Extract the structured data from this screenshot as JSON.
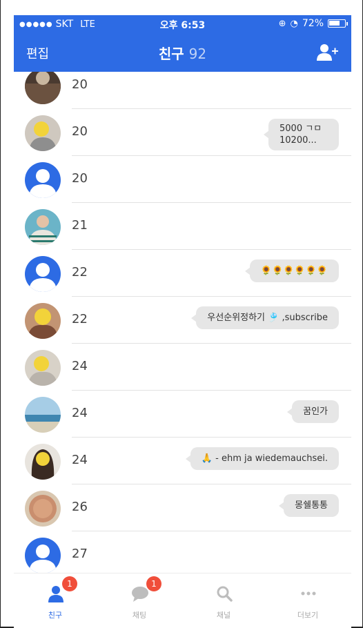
{
  "status": {
    "carrier": "SKT",
    "network": "LTE",
    "time": "오후 6:53",
    "battery": "72%",
    "battery_level": 0.72
  },
  "navbar": {
    "edit_label": "편집",
    "title": "친구",
    "count": "92"
  },
  "friends": [
    {
      "name": "20",
      "avatar": "photo-room",
      "message": ""
    },
    {
      "name": "20",
      "avatar": "photo-girl-yellow",
      "message": "5000 ㄱㅁ\n10200..."
    },
    {
      "name": "20",
      "avatar": "default",
      "message": ""
    },
    {
      "name": "21",
      "avatar": "photo-person-striped",
      "message": ""
    },
    {
      "name": "22",
      "avatar": "default",
      "message": "🌻🌻🌻🌻🌻🌻"
    },
    {
      "name": "22",
      "avatar": "photo-girl-drawn",
      "message": "우선순위정하기 🎐 ,subscribe"
    },
    {
      "name": "24",
      "avatar": "photo-girl-hat",
      "message": ""
    },
    {
      "name": "24",
      "avatar": "photo-beach",
      "message": "꿈인가"
    },
    {
      "name": "24",
      "avatar": "photo-girl-dark",
      "message": "🙏 - ehm ja wiedemauchsei."
    },
    {
      "name": "26",
      "avatar": "photo-plate",
      "message": "몽쉘통통"
    },
    {
      "name": "27",
      "avatar": "default",
      "message": ""
    }
  ],
  "tabs": [
    {
      "label": "친구",
      "icon": "person-icon",
      "badge": "1",
      "active": true
    },
    {
      "label": "채팅",
      "icon": "chat-bubble-icon",
      "badge": "1",
      "active": false
    },
    {
      "label": "채널",
      "icon": "search-icon",
      "badge": "",
      "active": false
    },
    {
      "label": "더보기",
      "icon": "more-dots-icon",
      "badge": "",
      "active": false
    }
  ],
  "colors": {
    "accent": "#2d6be4",
    "badge": "#f04e3a",
    "bubble": "#e6e6e6"
  }
}
